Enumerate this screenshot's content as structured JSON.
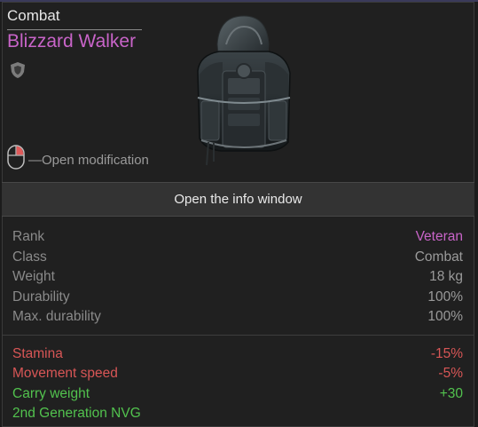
{
  "item": {
    "category": "Combat",
    "name": "Blizzard Walker",
    "modification_hint": "—Open modification"
  },
  "actions": {
    "info_window": "Open the info window"
  },
  "stats": [
    {
      "label": "Rank",
      "value": "Veteran",
      "value_color": "#c864c8"
    },
    {
      "label": "Class",
      "value": "Combat"
    },
    {
      "label": "Weight",
      "value": "18 kg"
    },
    {
      "label": "Durability",
      "value": "100%"
    },
    {
      "label": "Max. durability",
      "value": "100%"
    }
  ],
  "effects": [
    {
      "label": "Stamina",
      "value": "-15%",
      "color": "#d85656"
    },
    {
      "label": "Movement speed",
      "value": "-5%",
      "color": "#d85656"
    },
    {
      "label": "Carry weight",
      "value": "+30",
      "color": "#52c24e"
    },
    {
      "label": "2nd Generation NVG",
      "value": "",
      "color": "#52c24e"
    }
  ],
  "icons": {
    "badge": "shield-icon",
    "mouse": "mouse-right-click-icon",
    "item": "backpack-armor-image"
  }
}
